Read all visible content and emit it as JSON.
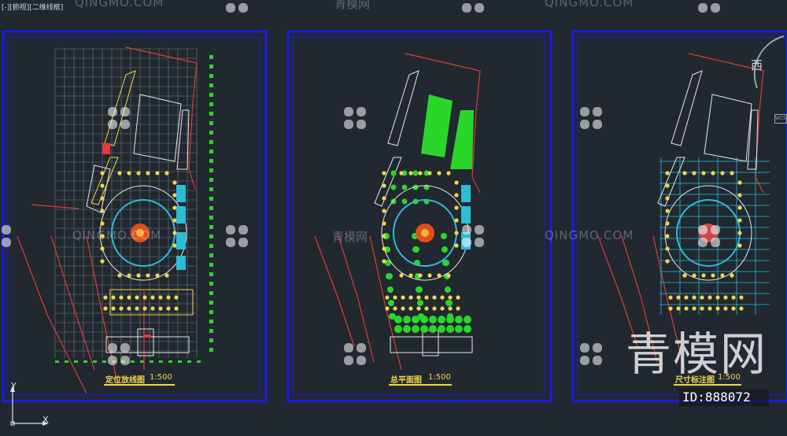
{
  "viewport": {
    "label": "[-][俯视][二维线框]"
  },
  "sheets": [
    {
      "title": "定位放线图",
      "scale": "1:500"
    },
    {
      "title": "总平面图",
      "scale": "1:500"
    },
    {
      "title": "尺寸标注图",
      "scale": "1:500"
    }
  ],
  "watermark": {
    "latin": "QINGMO.COM",
    "chinese_small": "青模网",
    "chinese_large": "青模网",
    "id_label": "ID:888072"
  },
  "ucs": {
    "x_label": "X",
    "y_label": "Y"
  },
  "viewcube": {
    "direction_label": "西",
    "wcs_label": "WCS"
  },
  "colors": {
    "background": "#212830",
    "frame_blue": "#1a1ae6",
    "title_yellow": "#f2d64b",
    "grid_green": "#2bd62b",
    "line_red": "#e03a3a"
  }
}
